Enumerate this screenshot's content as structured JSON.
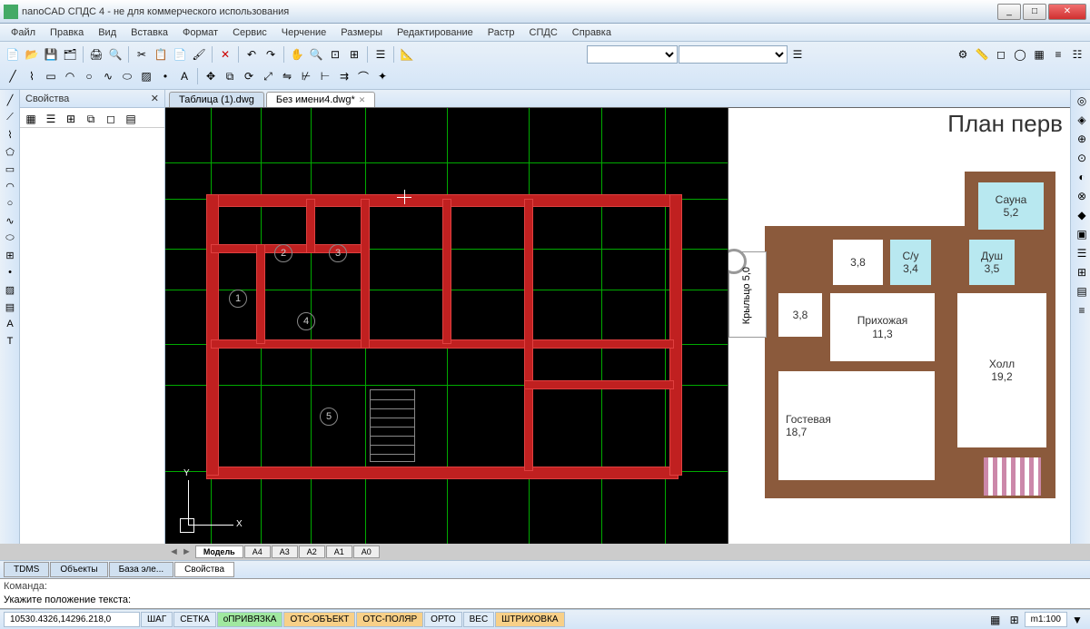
{
  "window": {
    "title": "nanoCAD СПДС 4 - не для коммерческого использования",
    "min": "_",
    "max": "□",
    "close": "✕"
  },
  "menu": [
    "Файл",
    "Правка",
    "Вид",
    "Вставка",
    "Формат",
    "Сервис",
    "Черчение",
    "Размеры",
    "Редактирование",
    "Растр",
    "СПДС",
    "Справка"
  ],
  "panels": {
    "properties_title": "Свойства"
  },
  "tabs": {
    "files": [
      {
        "label": "Таблица (1).dwg",
        "active": false
      },
      {
        "label": "Без имени4.dwg*",
        "active": true
      }
    ],
    "bottom": [
      {
        "label": "TDMS"
      },
      {
        "label": "Объекты"
      },
      {
        "label": "База эле..."
      },
      {
        "label": "Свойства",
        "active": true
      }
    ],
    "layouts": [
      {
        "label": "Модель",
        "active": true
      },
      {
        "label": "A4"
      },
      {
        "label": "A3"
      },
      {
        "label": "A2"
      },
      {
        "label": "A1"
      },
      {
        "label": "A0"
      }
    ]
  },
  "command": {
    "label": "Команда:",
    "prompt": "Укажите положение текста:"
  },
  "status": {
    "coords": "10530.4326,14296.218,0",
    "toggles": [
      {
        "label": "ШАГ",
        "state": "off"
      },
      {
        "label": "СЕТКА",
        "state": "off"
      },
      {
        "label": "оПРИВЯЗКА",
        "state": "on"
      },
      {
        "label": "ОТС-ОБЪЕКТ",
        "state": "orange"
      },
      {
        "label": "ОТС-ПОЛЯР",
        "state": "orange"
      },
      {
        "label": "ОРТО",
        "state": "off"
      },
      {
        "label": "ВЕС",
        "state": "off"
      },
      {
        "label": "ШТРИХОВКА",
        "state": "orange"
      }
    ],
    "scale_label": "m1:100"
  },
  "cad": {
    "room_markers": [
      "1",
      "2",
      "3",
      "4",
      "5"
    ],
    "axis_x": "X",
    "axis_y": "Y"
  },
  "floorplan": {
    "title": "План перв",
    "porch": {
      "name": "Крыльцо",
      "area": "5,0"
    },
    "rooms": [
      {
        "key": "sauna",
        "name": "Сауна",
        "area": "5,2",
        "wet": true
      },
      {
        "key": "r38a",
        "name": "",
        "area": "3,8",
        "wet": false
      },
      {
        "key": "wc",
        "name": "С/у",
        "area": "3,4",
        "wet": true
      },
      {
        "key": "shower",
        "name": "Душ",
        "area": "3,5",
        "wet": true
      },
      {
        "key": "r38b",
        "name": "",
        "area": "3,8",
        "wet": false
      },
      {
        "key": "hallway",
        "name": "Прихожая",
        "area": "11,3",
        "wet": false
      },
      {
        "key": "hall",
        "name": "Холл",
        "area": "19,2",
        "wet": false
      },
      {
        "key": "guest",
        "name": "Гостевая",
        "area": "18,7",
        "wet": false
      }
    ]
  }
}
